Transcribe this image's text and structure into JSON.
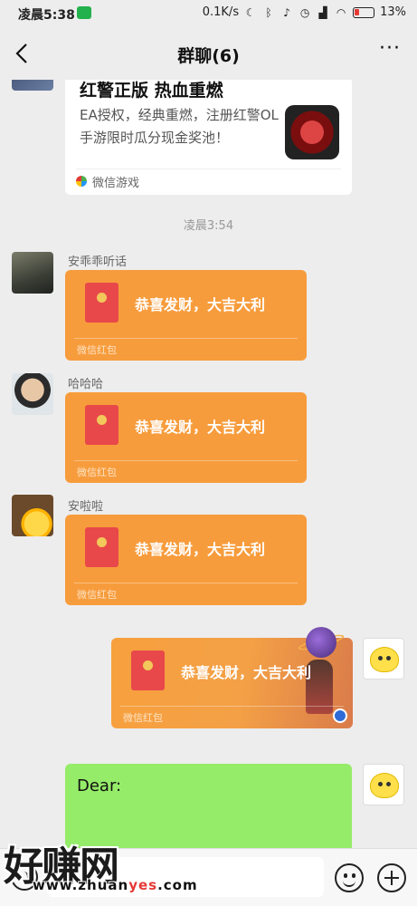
{
  "status_bar": {
    "time": "凌晨5:38",
    "network_speed": "0.1K/s",
    "battery": "13%"
  },
  "header": {
    "title": "群聊(6)",
    "more_label": "···"
  },
  "game_card": {
    "title": "红警正版 热血重燃",
    "description": "EA授权，经典重燃，注册红警OL手游限时瓜分现金奖池！",
    "source": "微信游戏"
  },
  "timestamp": "凌晨3:54",
  "messages": [
    {
      "sender": "安乖乖听话",
      "packet_text": "恭喜发财，大吉大利",
      "packet_label": "微信红包"
    },
    {
      "sender": "哈哈哈",
      "packet_text": "恭喜发财，大吉大利",
      "packet_label": "微信红包"
    },
    {
      "sender": "安啦啦",
      "packet_text": "恭喜发财，大吉大利",
      "packet_label": "微信红包"
    }
  ],
  "my_packet": {
    "packet_text": "恭喜发财，大吉大利",
    "packet_label": "微信红包"
  },
  "my_text": "Dear:",
  "watermark": {
    "brand": "好赚网",
    "url_prefix": "www.zhuan",
    "url_accent": "yes",
    "url_suffix": ".com"
  },
  "colors": {
    "packet": "#f79c3c",
    "my_bubble": "#95ec69",
    "background": "#ededed"
  }
}
